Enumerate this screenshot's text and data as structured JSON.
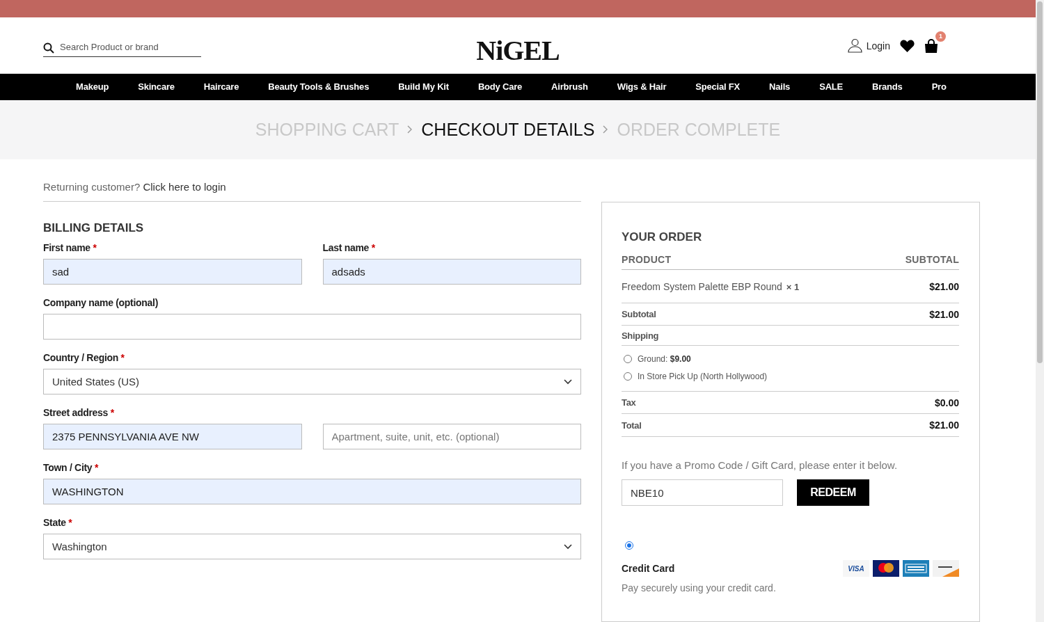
{
  "header": {
    "search": {
      "placeholder": "Search Product or brand"
    },
    "logo": "NiGEL",
    "login": "Login",
    "cart_count": "1"
  },
  "nav": [
    "Makeup",
    "Skincare",
    "Haircare",
    "Beauty Tools & Brushes",
    "Build My Kit",
    "Body Care",
    "Airbrush",
    "Wigs & Hair",
    "Special FX",
    "Nails",
    "SALE",
    "Brands",
    "Pro"
  ],
  "steps": [
    {
      "label": "SHOPPING CART",
      "selected": false
    },
    {
      "label": "CHECKOUT DETAILS",
      "selected": true
    },
    {
      "label": "ORDER COMPLETE",
      "selected": false
    }
  ],
  "returning": {
    "text": "Returning customer?",
    "link": "Click here to login"
  },
  "billing": {
    "title": "BILLING DETAILS",
    "rows": [
      [
        {
          "kind": "input",
          "label": "First name",
          "required_mark": "*",
          "value": "sad",
          "autofilled": true
        },
        {
          "kind": "input",
          "label": "Last name",
          "required_mark": "*",
          "value": "adsads",
          "autofilled": true
        }
      ],
      [
        {
          "kind": "input",
          "label": "Company name (optional)",
          "autofilled": false
        }
      ],
      [
        {
          "kind": "select",
          "label": "Country / Region",
          "required_mark": "*",
          "value": "United States (US)"
        }
      ],
      [
        {
          "kind": "input",
          "label": "Street address",
          "required_mark": "*",
          "value": "2375 PENNSYLVANIA AVE NW",
          "autofilled": true
        },
        {
          "kind": "input",
          "placeholder": "Apartment, suite, unit, etc. (optional)",
          "autofilled": false
        }
      ],
      [
        {
          "kind": "input",
          "label": "Town / City",
          "required_mark": "*",
          "value": "WASHINGTON",
          "autofilled": true
        }
      ],
      [
        {
          "kind": "select",
          "label": "State",
          "required_mark": "*",
          "value": "Washington"
        }
      ]
    ]
  },
  "order": {
    "title": "YOUR ORDER",
    "columns": [
      "PRODUCT",
      "SUBTOTAL"
    ],
    "items": [
      {
        "name": "Freedom System Palette EBP Round",
        "qty": "× 1",
        "price": "$21.00"
      }
    ],
    "subtotal": {
      "label": "Subtotal",
      "value": "$21.00"
    },
    "shipping": {
      "label": "Shipping",
      "options": [
        {
          "label": "Ground:",
          "price": "$9.00",
          "selected": false
        },
        {
          "label": "In Store Pick Up (North Hollywood)",
          "selected": false
        }
      ]
    },
    "tax": {
      "label": "Tax",
      "value": "$0.00"
    },
    "total": {
      "label": "Total",
      "value": "$21.00"
    },
    "promo": {
      "text": "If you have a Promo Code / Gift Card, please enter it below.",
      "value": "NBE10",
      "button": "REDEEM"
    },
    "payment": {
      "selected": true,
      "title": "Credit Card",
      "description": "Pay securely using your credit card.",
      "cards": [
        {
          "kind": "visa",
          "label": "VISA"
        },
        {
          "kind": "mastercard"
        },
        {
          "kind": "amex"
        },
        {
          "kind": "discover"
        }
      ]
    }
  }
}
